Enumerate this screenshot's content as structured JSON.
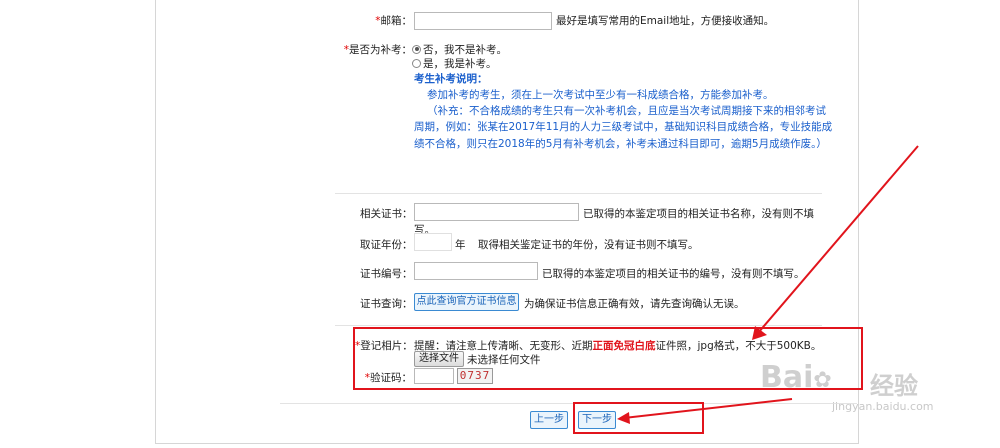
{
  "email": {
    "required_mark": "*",
    "label": "邮箱：",
    "value": "",
    "hint": "最好是填写常用的Email地址，方便接收通知。"
  },
  "retake": {
    "required_mark": "*",
    "label": "是否为补考：",
    "options": [
      {
        "label": "否，我不是补考。",
        "selected": true
      },
      {
        "label": "是，我是补考。",
        "selected": false
      }
    ],
    "note_title": "考生补考说明：",
    "note_line1": "参加补考的考生，须在上一次考试中至少有一科成绩合格，方能参加补考。",
    "note_line2": "（补充：不合格成绩的考生只有一次补考机会，且应是当次考试周期接下来的相邻考试",
    "note_line3": "周期，例如：张某在2017年11月的人力三级考试中，基础知识科目成绩合格，专业技能成",
    "note_line4": "绩不合格，则只在2018年的5月有补考机会，补考未通过科目即可，逾期5月成绩作废。）"
  },
  "related_cert": {
    "label": "相关证书：",
    "value": "",
    "hint_line1": "已取得的本鉴定项目的相关证书名称，没有则不填",
    "hint_line2": "写。"
  },
  "cert_year": {
    "label": "取证年份：",
    "value": "",
    "unit": "年",
    "hint": "取得相关鉴定证书的年份，没有证书则不填写。"
  },
  "cert_number": {
    "label": "证书编号：",
    "value": "",
    "hint": "已取得的本鉴定项目的相关证书的编号，没有则不填写。"
  },
  "cert_query": {
    "label": "证书查询：",
    "button_label": "点此查询官方证书信息",
    "hint": "为确保证书信息正确有效，请先查询确认无误。"
  },
  "photo": {
    "required_mark": "*",
    "label": "登记相片：",
    "reminder_prefix": "提醒：请注意上传清晰、无变形、近期",
    "reminder_highlight": "正面免冠白底",
    "reminder_suffix": "证件照，jpg格式，不大于500KB。",
    "file_button_label": "选择文件",
    "file_status": "未选择任何文件"
  },
  "captcha": {
    "required_mark": "*",
    "label": "验证码：",
    "value": "",
    "image_text": "0737"
  },
  "nav": {
    "prev_label": "上一步",
    "next_label": "下一步"
  },
  "watermark": {
    "brand": "Bai",
    "brand_suffix": "经验",
    "url": "jingyan.baidu.com"
  },
  "colors": {
    "required": "#e00000",
    "note_blue": "#1a5fcc",
    "highlight_red": "#e1141c",
    "annotation_red": "#e1141c"
  }
}
